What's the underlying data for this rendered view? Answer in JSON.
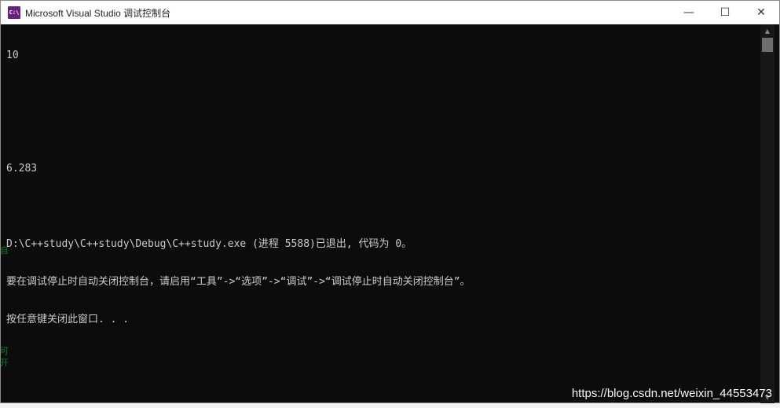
{
  "window": {
    "title": "Microsoft Visual Studio 调试控制台",
    "icon": "visual-studio-console-icon",
    "icon_text": "C:\\",
    "controls": {
      "minimize": "—",
      "maximize": "☐",
      "close": "✕"
    }
  },
  "console": {
    "lines": [
      "10",
      "",
      "",
      "6.283",
      "",
      "D:\\C++study\\C++study\\Debug\\C++study.exe (进程 5588)已退出, 代码为 0。",
      "要在调试停止时自动关闭控制台，请启用“工具”->“选项”->“调试”->“调试停止时自动关闭控制台”。",
      "按任意键关闭此窗口. . ."
    ]
  },
  "scrollbar": {
    "up_arrow": "▲",
    "down_arrow": "▼"
  },
  "watermark": "https://blog.csdn.net/weixin_44553473",
  "background_fragments": {
    "a": "自",
    "b": "可",
    "c": "开"
  },
  "colors": {
    "console_bg": "#0c0c0c",
    "console_text": "#cccccc",
    "titlebar_bg": "#ffffff",
    "icon_bg": "#68217a"
  }
}
